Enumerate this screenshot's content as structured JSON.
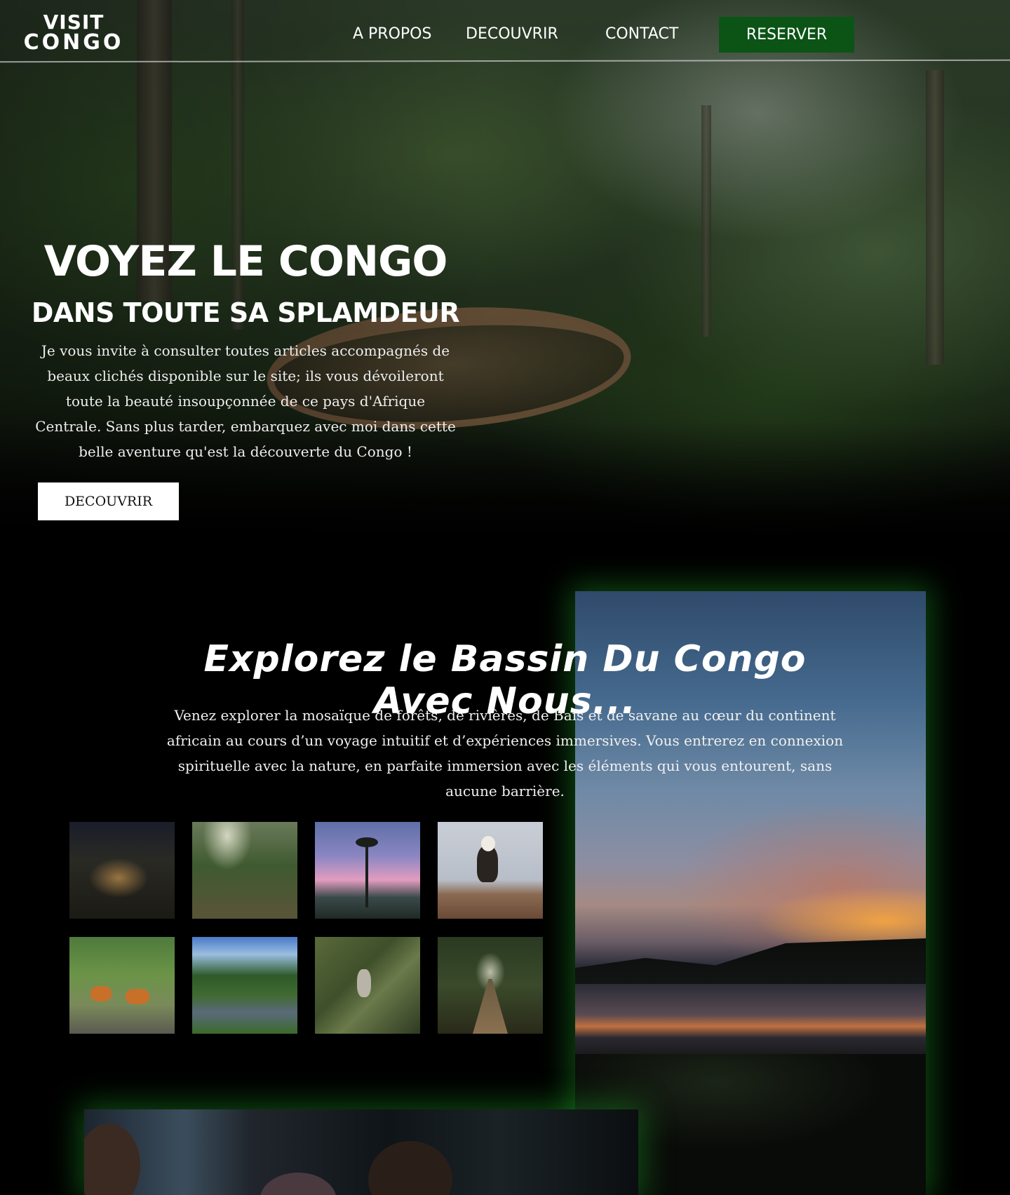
{
  "nav": {
    "logo_top": "VISIT",
    "logo_bottom": "CONGO",
    "links": [
      "A PROPOS",
      "DECOUVRIR",
      "CONTACT"
    ],
    "reserve_label": "RESERVER"
  },
  "hero": {
    "title": "VOYEZ LE CONGO",
    "subtitle": "DANS TOUTE SA SPLAMDEUR",
    "text": "Je vous invite à consulter toutes articles accompagnés de beaux clichés disponible sur le site; ils vous dévoileront toute la beauté insoupçonnée de ce pays d'Afrique Centrale. Sans plus tarder, embarquez avec moi dans cette belle aventure qu'est la découverte du Congo !",
    "button_label": "DECOUVRIR"
  },
  "explore": {
    "title": "Explorez le Bassin Du Congo Avec Nous...",
    "text": "Venez explorer la mosaïque de forêts,  de rivières, de Baïs et de savane au cœur du continent africain au cours d’un voyage intuitif et d’expériences immersives. Vous entrerez en connexion spirituelle avec la nature, en parfaite immersion avec les éléments qui vous entourent, sans aucune barrière."
  },
  "gallery": [
    "treehouse-night-photo",
    "forest-hikers-photo",
    "tree-sunset-photo",
    "eagle-on-rock-photo",
    "antelopes-photo",
    "forest-stream-photo",
    "person-on-mossy-tree-photo",
    "wooden-walkway-photo"
  ],
  "colors": {
    "accent_green": "#0b5416",
    "glow_green": "#1ea028",
    "background": "#000000"
  }
}
